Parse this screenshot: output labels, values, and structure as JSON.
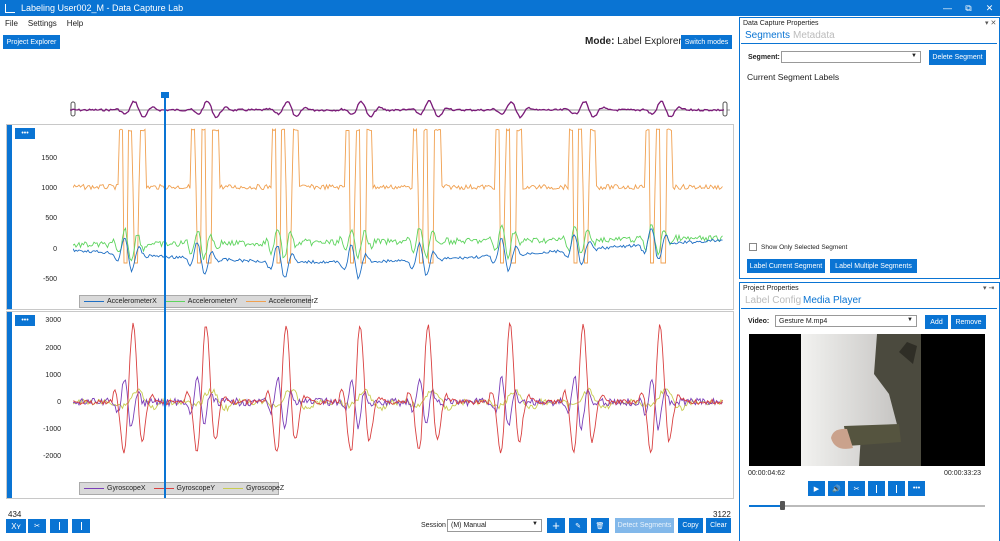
{
  "window": {
    "title": "Labeling User002_M - Data Capture Lab",
    "controls": [
      "—",
      "⧉",
      "✕"
    ]
  },
  "menu": [
    "File",
    "Settings",
    "Help"
  ],
  "toolbar": {
    "project_explorer": "Project Explorer",
    "mode_label": "Mode:",
    "mode_value": "Label Explorer",
    "switch_modes": "Switch modes"
  },
  "chart1": {
    "menu": "•••",
    "yticks": [
      "1500",
      "1000",
      "500",
      "0",
      "-500"
    ],
    "legend": [
      {
        "name": "AccelerometerX",
        "color": "#1f6fc4"
      },
      {
        "name": "AccelerometerY",
        "color": "#5fd45f"
      },
      {
        "name": "AccelerometerZ",
        "color": "#f0a050"
      }
    ]
  },
  "chart2": {
    "menu": "•••",
    "yticks": [
      "3000",
      "2000",
      "1000",
      "0",
      "-1000",
      "-2000"
    ],
    "legend": [
      {
        "name": "GyroscopeX",
        "color": "#7b3fb8"
      },
      {
        "name": "GyroscopeY",
        "color": "#d94040"
      },
      {
        "name": "GyroscopeZ",
        "color": "#c8cc50"
      }
    ]
  },
  "range": {
    "start": "434",
    "end": "3122"
  },
  "bottom": {
    "xy": "Xʏ",
    "session_label": "Session",
    "session_value": "(M) Manual",
    "detect": "Detect Segments",
    "copy": "Copy",
    "clear": "Clear"
  },
  "dcp": {
    "title": "Data Capture Properties",
    "tab_active": "Segments",
    "tab_inactive": "Metadata",
    "segment_label": "Segment:",
    "segment_value": "",
    "delete": "Delete Segment",
    "current_labels": "Current Segment Labels",
    "show_only": "Show Only Selected Segment",
    "label_current": "Label Current Segment",
    "label_multiple": "Label Multiple Segments"
  },
  "pp": {
    "title": "Project Properties",
    "tab_inactive": "Label Config",
    "tab_active": "Media Player",
    "video_label": "Video:",
    "video_value": "Gesture M.mp4",
    "add": "Add",
    "remove": "Remove",
    "time_current": "00:00:04:62",
    "time_total": "00:00:33:23",
    "progress": 0.15
  }
}
